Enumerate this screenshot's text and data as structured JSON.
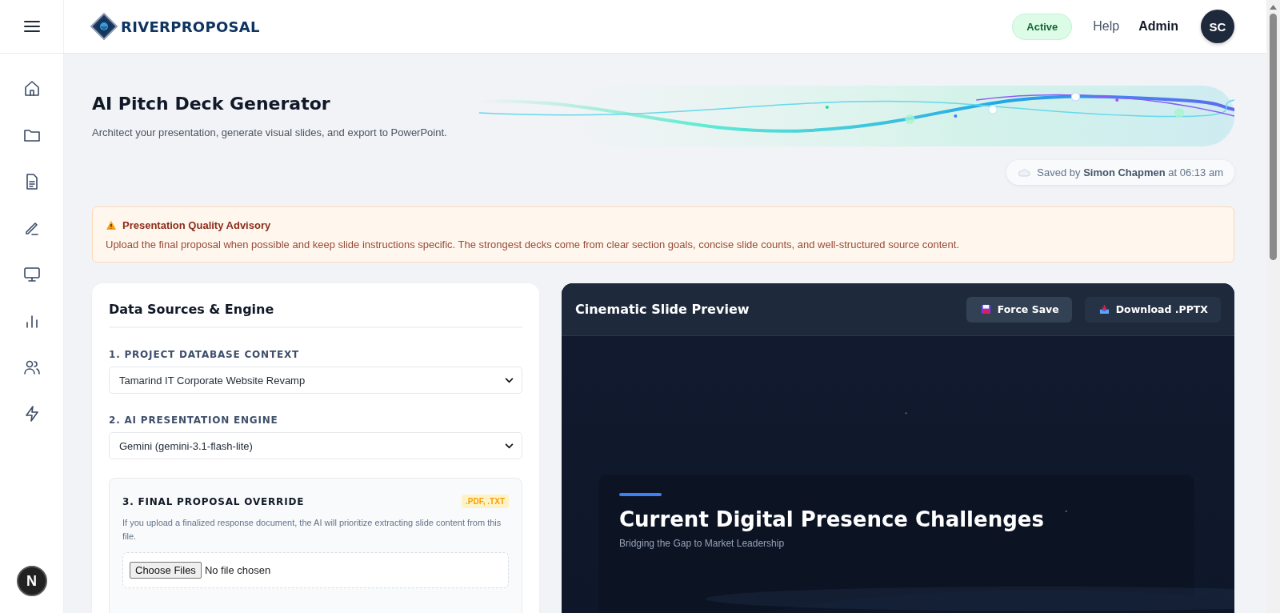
{
  "header": {
    "logo_text": "RIVERPROPOSAL",
    "status_badge": "Active",
    "avatar_initials": "SC",
    "links": [
      {
        "label": "Help",
        "kind": "link"
      },
      {
        "label": "Admin",
        "kind": "user"
      }
    ]
  },
  "sidebar": {
    "dev_badge": "N"
  },
  "page": {
    "title": "AI Pitch Deck Generator",
    "subtitle": "Architect your presentation, generate visual slides, and export to PowerPoint.",
    "saved": "Saved by **Simon Chapmen** at 06:13 am"
  },
  "advisory": {
    "title": "Presentation Quality Advisory",
    "text": "Upload the final proposal when possible and keep slide instructions specific. The strongest decks come from clear section goals, concise slide counts, and well-structured source content."
  },
  "data_panel": {
    "title": "Data Sources & Engine",
    "fields": [
      {
        "label": "1. PROJECT DATABASE CONTEXT",
        "value": "Tamarind IT Corporate Website Revamp"
      },
      {
        "label": "2. AI PRESENTATION ENGINE",
        "value": "Gemini (gemini-3.1-flash-lite)"
      }
    ],
    "override": {
      "title": "3. FINAL PROPOSAL OVERRIDE",
      "badge": ".PDF, .TXT",
      "description": "If you upload a finalized response document, the AI will prioritize extracting slide content from this file.",
      "file_button": "Choose Files",
      "file_status": "No file chosen"
    }
  },
  "preview": {
    "title": "Cinematic Slide Preview",
    "buttons": [
      {
        "label": "Force Save",
        "kind": "save"
      },
      {
        "label": "Download .PPTX",
        "kind": "download"
      }
    ],
    "slide": {
      "title": "Current Digital Presence Challenges",
      "subtitle": "Bridging the Gap to Market Leadership"
    }
  }
}
